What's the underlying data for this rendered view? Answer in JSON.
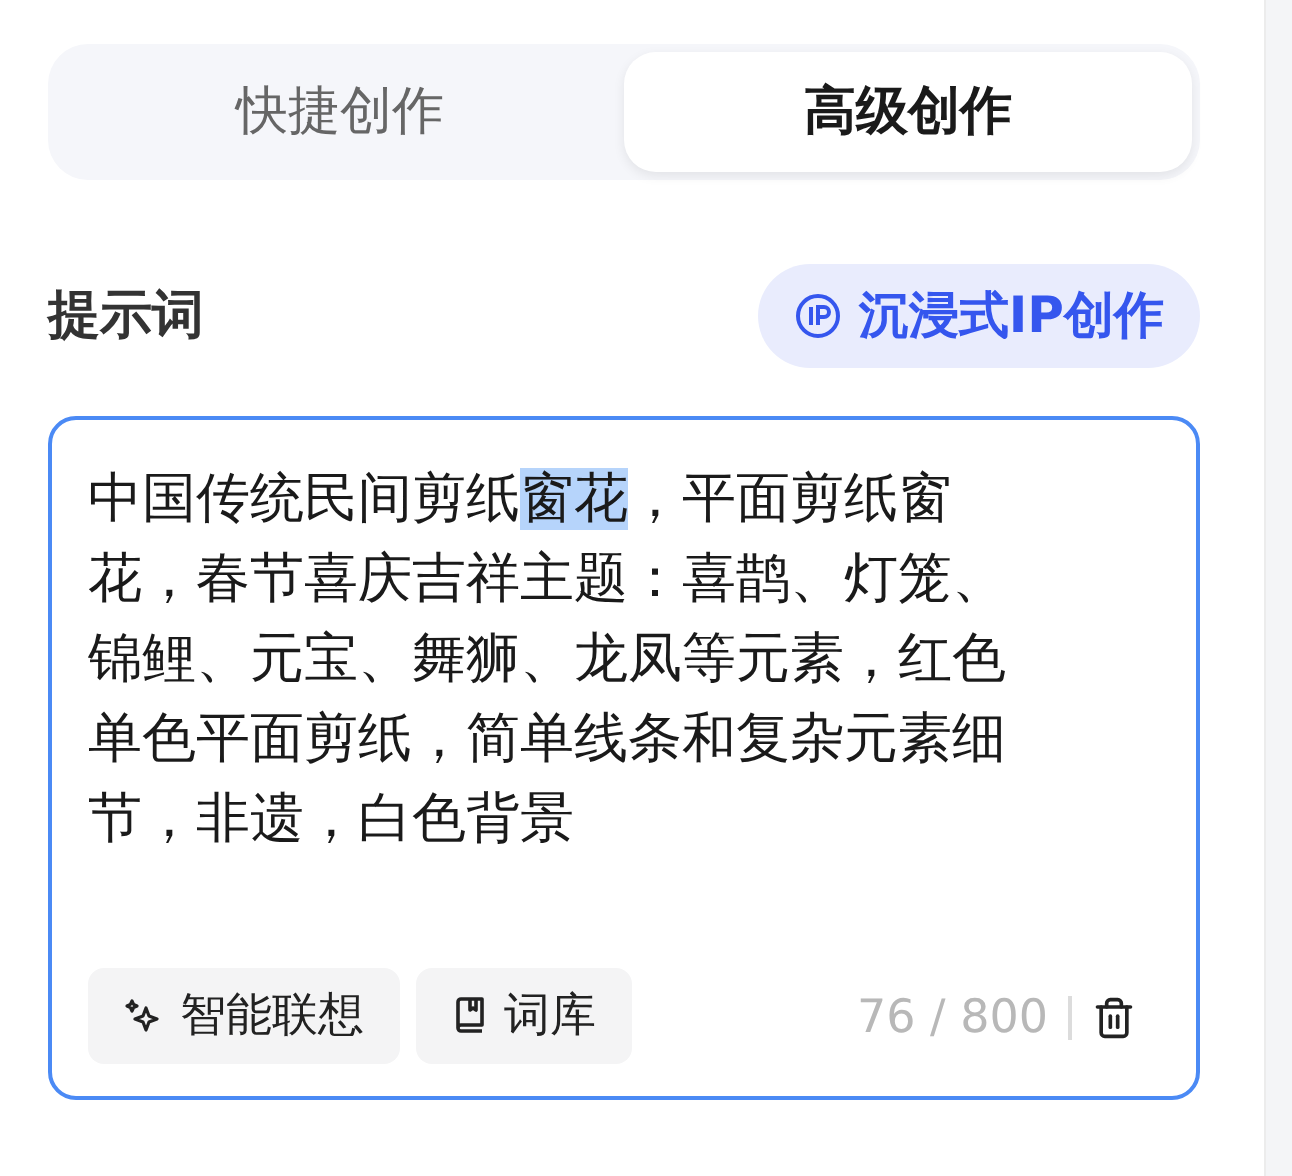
{
  "tabs": [
    {
      "label": "快捷创作",
      "selected": false
    },
    {
      "label": "高级创作",
      "selected": true
    }
  ],
  "prompt": {
    "label": "提示词",
    "ip_button": "沉浸式IP创作",
    "text_before": "中国传统民间剪纸",
    "text_selected": "窗花",
    "text_after": "，平面剪纸窗花，春节喜庆吉祥主题：喜鹊、灯笼、锦鲤、元宝、舞狮、龙凤等元素，红色单色平面剪纸，简单线条和复杂元素细节，非遗，白色背景",
    "focused": true,
    "tools": [
      {
        "kind": "sparkle",
        "label": "智能联想"
      },
      {
        "kind": "book",
        "label": "词库"
      }
    ],
    "counter": "76 / 800"
  }
}
